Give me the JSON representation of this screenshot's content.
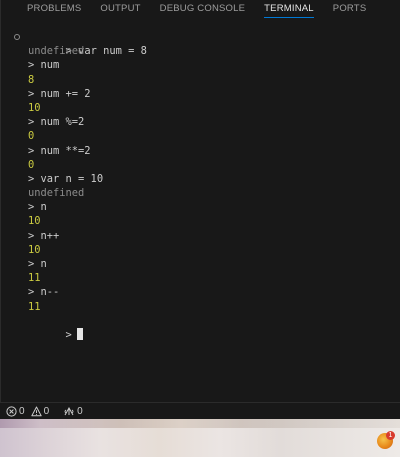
{
  "tabs": [
    {
      "label": "PROBLEMS",
      "active": false
    },
    {
      "label": "OUTPUT",
      "active": false
    },
    {
      "label": "DEBUG CONSOLE",
      "active": false
    },
    {
      "label": "TERMINAL",
      "active": true
    },
    {
      "label": "PORTS",
      "active": false
    }
  ],
  "terminal": {
    "prompt": ">",
    "lines": [
      {
        "kind": "in",
        "text": "> var num = 8"
      },
      {
        "kind": "out-undef",
        "text": "undefined"
      },
      {
        "kind": "in",
        "text": "> num"
      },
      {
        "kind": "out-num",
        "text": "8"
      },
      {
        "kind": "in",
        "text": "> num += 2"
      },
      {
        "kind": "out-num",
        "text": "10"
      },
      {
        "kind": "in",
        "text": "> num %=2"
      },
      {
        "kind": "out-num",
        "text": "0"
      },
      {
        "kind": "in",
        "text": "> num **=2"
      },
      {
        "kind": "out-num",
        "text": "0"
      },
      {
        "kind": "in",
        "text": "> var n = 10"
      },
      {
        "kind": "out-undef",
        "text": "undefined"
      },
      {
        "kind": "in",
        "text": "> n"
      },
      {
        "kind": "out-num",
        "text": "10"
      },
      {
        "kind": "in",
        "text": "> n++"
      },
      {
        "kind": "out-num",
        "text": "10"
      },
      {
        "kind": "in",
        "text": "> n"
      },
      {
        "kind": "out-num",
        "text": "11"
      },
      {
        "kind": "in",
        "text": "> n--"
      },
      {
        "kind": "out-num",
        "text": "11"
      }
    ]
  },
  "statusbar": {
    "errors": "0",
    "warnings": "0",
    "ports": "0"
  },
  "taskbar": {
    "app_badge": "1"
  },
  "colors": {
    "number_output": "#cbcb41",
    "undefined_output": "#8b8b8b",
    "input_text": "#cccccc",
    "active_tab_underline": "#0078d4"
  },
  "icons": [
    "error-icon",
    "warning-icon",
    "ports-icon",
    "command-decoration-icon",
    "terminal-cursor"
  ]
}
